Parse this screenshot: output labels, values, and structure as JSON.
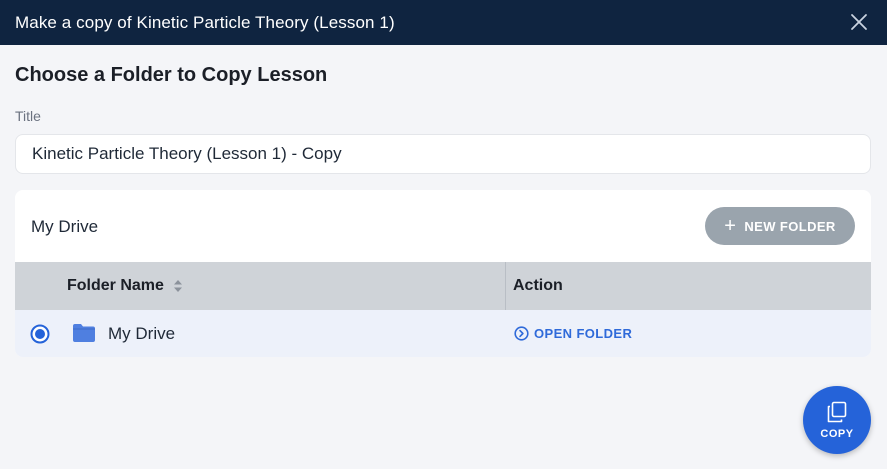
{
  "dialog": {
    "title": "Make a copy of Kinetic Particle Theory (Lesson 1)",
    "heading": "Choose a Folder to Copy Lesson"
  },
  "title_field": {
    "label": "Title",
    "value": "Kinetic Particle Theory (Lesson 1) - Copy"
  },
  "folder_panel": {
    "breadcrumb": "My Drive",
    "new_folder_label": "NEW FOLDER",
    "columns": [
      "Folder Name",
      "Action"
    ],
    "rows": [
      {
        "name": "My Drive",
        "action": "OPEN FOLDER",
        "selected": true
      }
    ]
  },
  "copy_button": {
    "label": "COPY"
  },
  "colors": {
    "titlebar": "#0f2440",
    "accent": "#2563d9",
    "link": "#2f6ad9",
    "disabled_button": "#9aa4ad",
    "table_header": "#cfd3d8",
    "selected_row": "#edf1fa"
  },
  "icons": {
    "close": "close-icon",
    "plus": "plus-icon",
    "sort": "sort-icon",
    "radio": "radio-selected-icon",
    "folder": "folder-icon",
    "open": "chevron-circle-right-icon",
    "copy": "copy-icon"
  }
}
